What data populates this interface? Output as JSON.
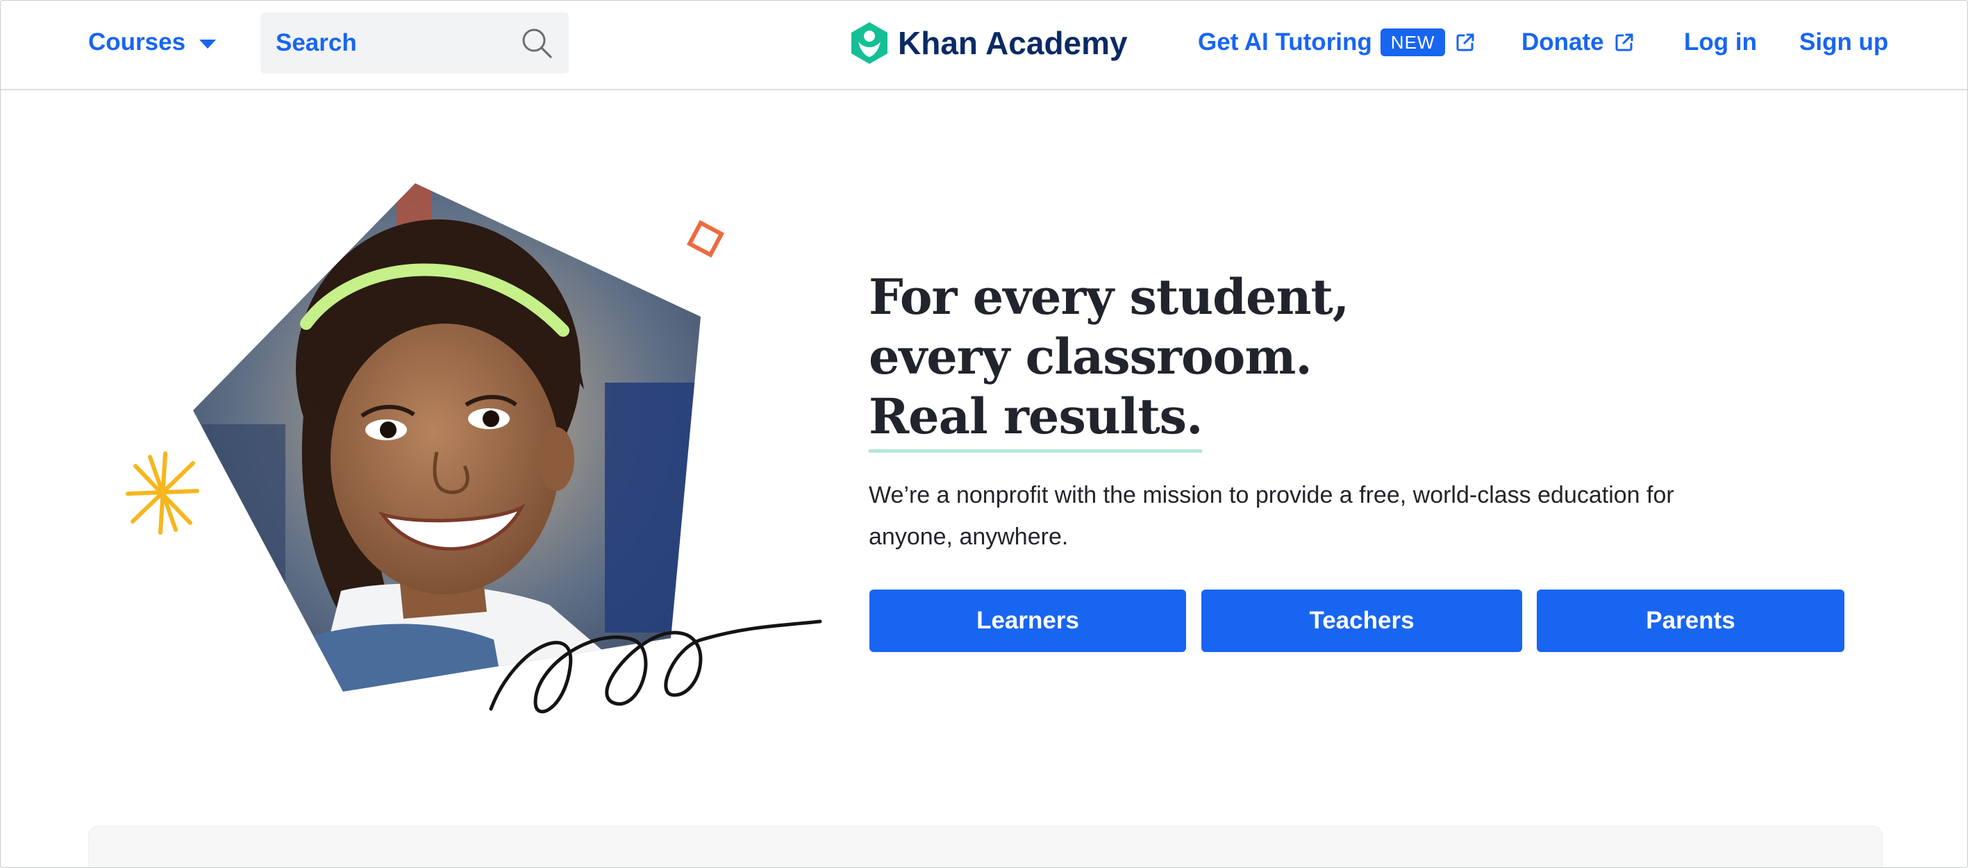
{
  "header": {
    "courses_label": "Courses",
    "search": {
      "placeholder": "Search"
    },
    "logo_text": "Khan Academy",
    "ai_tutoring_label": "Get AI Tutoring",
    "new_badge": "NEW",
    "donate_label": "Donate",
    "login_label": "Log in",
    "signup_label": "Sign up"
  },
  "hero": {
    "headline_line1": "For every student,",
    "headline_line2": "every classroom.",
    "headline_line3": "Real results.",
    "mission": "We’re a nonprofit with the mission to provide a free, world-class education for anyone, anywhere.",
    "buttons": {
      "learners": "Learners",
      "teachers": "Teachers",
      "parents": "Parents"
    }
  },
  "colors": {
    "brand_blue": "#1865f2",
    "logo_navy": "#0a2a66",
    "logo_green": "#14bf96",
    "accent_orange": "#ec6b3f",
    "accent_yellow": "#f7b61e",
    "underline_mint": "#b5e6d6"
  }
}
